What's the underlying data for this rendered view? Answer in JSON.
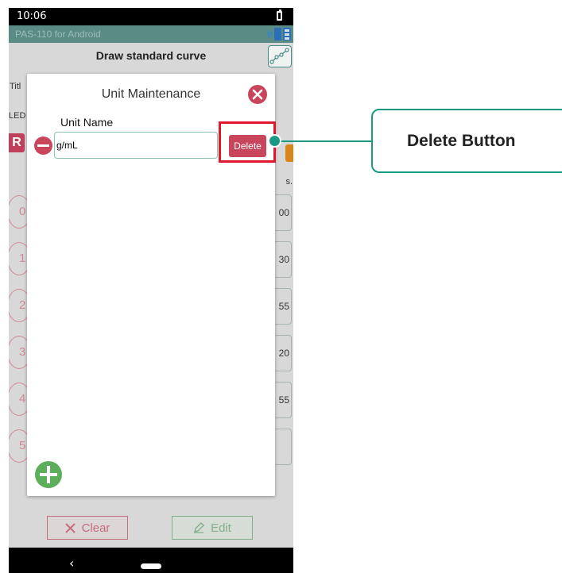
{
  "status_bar": {
    "time": "10:06"
  },
  "app_bar": {
    "title": "PAS-110 for Android"
  },
  "screen": {
    "title": "Draw standard curve",
    "title_field_label": "Titl",
    "led_label": "LED",
    "red_badge": "R",
    "column_suffix": "s.",
    "rows": [
      {
        "index": "0",
        "value": "00"
      },
      {
        "index": "1",
        "value": "30"
      },
      {
        "index": "2",
        "value": "55"
      },
      {
        "index": "3",
        "value": "20"
      },
      {
        "index": "4",
        "value": "55"
      },
      {
        "index": "5",
        "value": ""
      }
    ]
  },
  "bottom": {
    "clear_label": "Clear",
    "edit_label": "Edit"
  },
  "dialog": {
    "title": "Unit Maintenance",
    "unit_name_label": "Unit Name",
    "unit_value": "g/mL",
    "delete_label": "Delete"
  },
  "annotation": {
    "callout_text": "Delete Button"
  },
  "colors": {
    "accent_teal": "#1a9a82",
    "delete_red": "#c8455c",
    "add_green": "#5cae5a",
    "highlight_red": "#e1182b"
  }
}
